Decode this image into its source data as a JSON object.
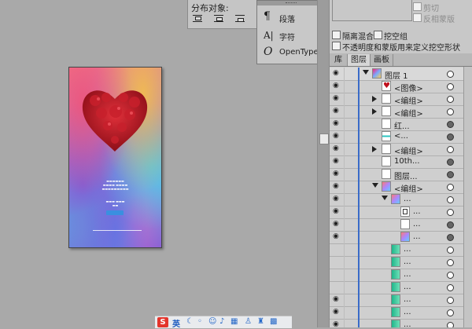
{
  "distribute": {
    "label": "分布对象:"
  },
  "glyph_menu": {
    "items": [
      {
        "glyph": "¶",
        "label": "段落"
      },
      {
        "glyph": "A|",
        "label": "字符"
      },
      {
        "glyph": "O",
        "label": "OpenType"
      }
    ]
  },
  "transparency": {
    "top_checks": [
      {
        "label": "剪切",
        "checked": false,
        "enabled": false
      },
      {
        "label": "反相蒙版",
        "checked": false,
        "enabled": false
      }
    ],
    "isolate_blending": "隔离混合",
    "knockout_group": "挖空组",
    "opacity_mask_option": "不透明度和蒙版用来定义挖空形状"
  },
  "tabs": [
    {
      "label": "库",
      "active": false
    },
    {
      "label": "图层",
      "active": true
    },
    {
      "label": "画板",
      "active": false
    }
  ],
  "layers": [
    {
      "name": "图层 1",
      "indent": 0,
      "expand": "down",
      "eye": true,
      "thumb": "heart-color",
      "target": false
    },
    {
      "name": "<图像>",
      "indent": 1,
      "expand": "none",
      "eye": true,
      "thumb": "heart",
      "target": false
    },
    {
      "name": "<编组>",
      "indent": 1,
      "expand": "right",
      "eye": true,
      "thumb": "white",
      "target": false
    },
    {
      "name": "<编组>",
      "indent": 1,
      "expand": "right",
      "eye": true,
      "thumb": "white",
      "target": false
    },
    {
      "name": "红...",
      "indent": 1,
      "expand": "none",
      "eye": true,
      "thumb": "white",
      "target": true
    },
    {
      "name": "<...",
      "indent": 1,
      "expand": "none",
      "eye": true,
      "thumb": "cyanline",
      "target": true
    },
    {
      "name": "<编组>",
      "indent": 1,
      "expand": "right",
      "eye": true,
      "thumb": "white",
      "target": false
    },
    {
      "name": "10th...",
      "indent": 1,
      "expand": "none",
      "eye": true,
      "thumb": "white",
      "target": true
    },
    {
      "name": "图层...",
      "indent": 1,
      "expand": "none",
      "eye": true,
      "thumb": "white",
      "target": true
    },
    {
      "name": "<编组>",
      "indent": 1,
      "expand": "down",
      "eye": true,
      "thumb": "colorful",
      "target": false
    },
    {
      "name": "...",
      "indent": 2,
      "expand": "down",
      "eye": true,
      "thumb": "colorful",
      "target": false
    },
    {
      "name": "...",
      "indent": 3,
      "expand": "none",
      "eye": true,
      "thumb": "frame",
      "target": false
    },
    {
      "name": "...",
      "indent": 3,
      "expand": "none",
      "eye": true,
      "thumb": "white",
      "target": true
    },
    {
      "name": "...",
      "indent": 3,
      "expand": "none",
      "eye": true,
      "thumb": "colorful",
      "target": true
    },
    {
      "name": "...",
      "indent": 2,
      "expand": "none",
      "eye": false,
      "thumb": "green",
      "target": false
    },
    {
      "name": "...",
      "indent": 2,
      "expand": "none",
      "eye": false,
      "thumb": "green",
      "target": false
    },
    {
      "name": "...",
      "indent": 2,
      "expand": "none",
      "eye": false,
      "thumb": "green",
      "target": false
    },
    {
      "name": "...",
      "indent": 2,
      "expand": "none",
      "eye": false,
      "thumb": "green",
      "target": false
    },
    {
      "name": "...",
      "indent": 2,
      "expand": "none",
      "eye": true,
      "thumb": "green",
      "target": false
    },
    {
      "name": "...",
      "indent": 2,
      "expand": "none",
      "eye": true,
      "thumb": "green",
      "target": false
    },
    {
      "name": "...",
      "indent": 2,
      "expand": "none",
      "eye": true,
      "thumb": "green",
      "target": false
    }
  ],
  "ime_bar": {
    "logo": "S",
    "mode": "英",
    "icons": [
      "moon-icon",
      "comma-icon",
      "smile-icon",
      "mic-icon",
      "keyboard-icon",
      "person-icon",
      "shirt-icon",
      "grid-icon"
    ]
  },
  "colors": {
    "selection": "#3a6bc8",
    "ime_red": "#e3352c"
  }
}
